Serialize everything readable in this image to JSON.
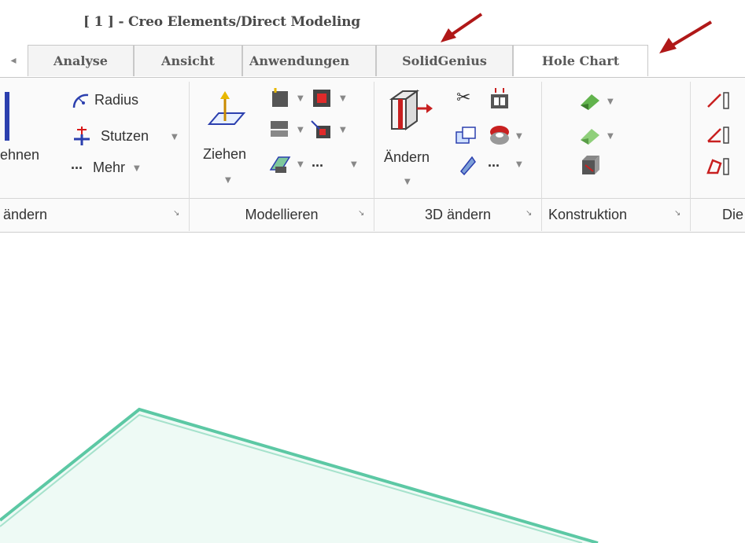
{
  "window": {
    "title": "[ 1 ] - Creo Elements/Direct Modeling"
  },
  "tabs": [
    {
      "label": "Analyse"
    },
    {
      "label": "Ansicht"
    },
    {
      "label": "Anwendungen"
    },
    {
      "label": "SolidGenius"
    },
    {
      "label": "Hole Chart"
    }
  ],
  "ribbon": {
    "group1": {
      "partial_label": "ehnen",
      "radius": "Radius",
      "stutzen": "Stutzen",
      "mehr": "Mehr",
      "footer": "ändern"
    },
    "modellieren": {
      "ziehen": "Ziehen",
      "footer": "Modellieren"
    },
    "aendern3d": {
      "aendern": "Ändern",
      "footer": "3D ändern"
    },
    "konstruktion": {
      "footer": "Konstruktion"
    },
    "last": {
      "footer": "Die"
    },
    "dots": "..."
  },
  "colors": {
    "annotation_arrow": "#b01818",
    "model_edge": "#5cc8a4",
    "model_fill": "#e4f6ef"
  }
}
